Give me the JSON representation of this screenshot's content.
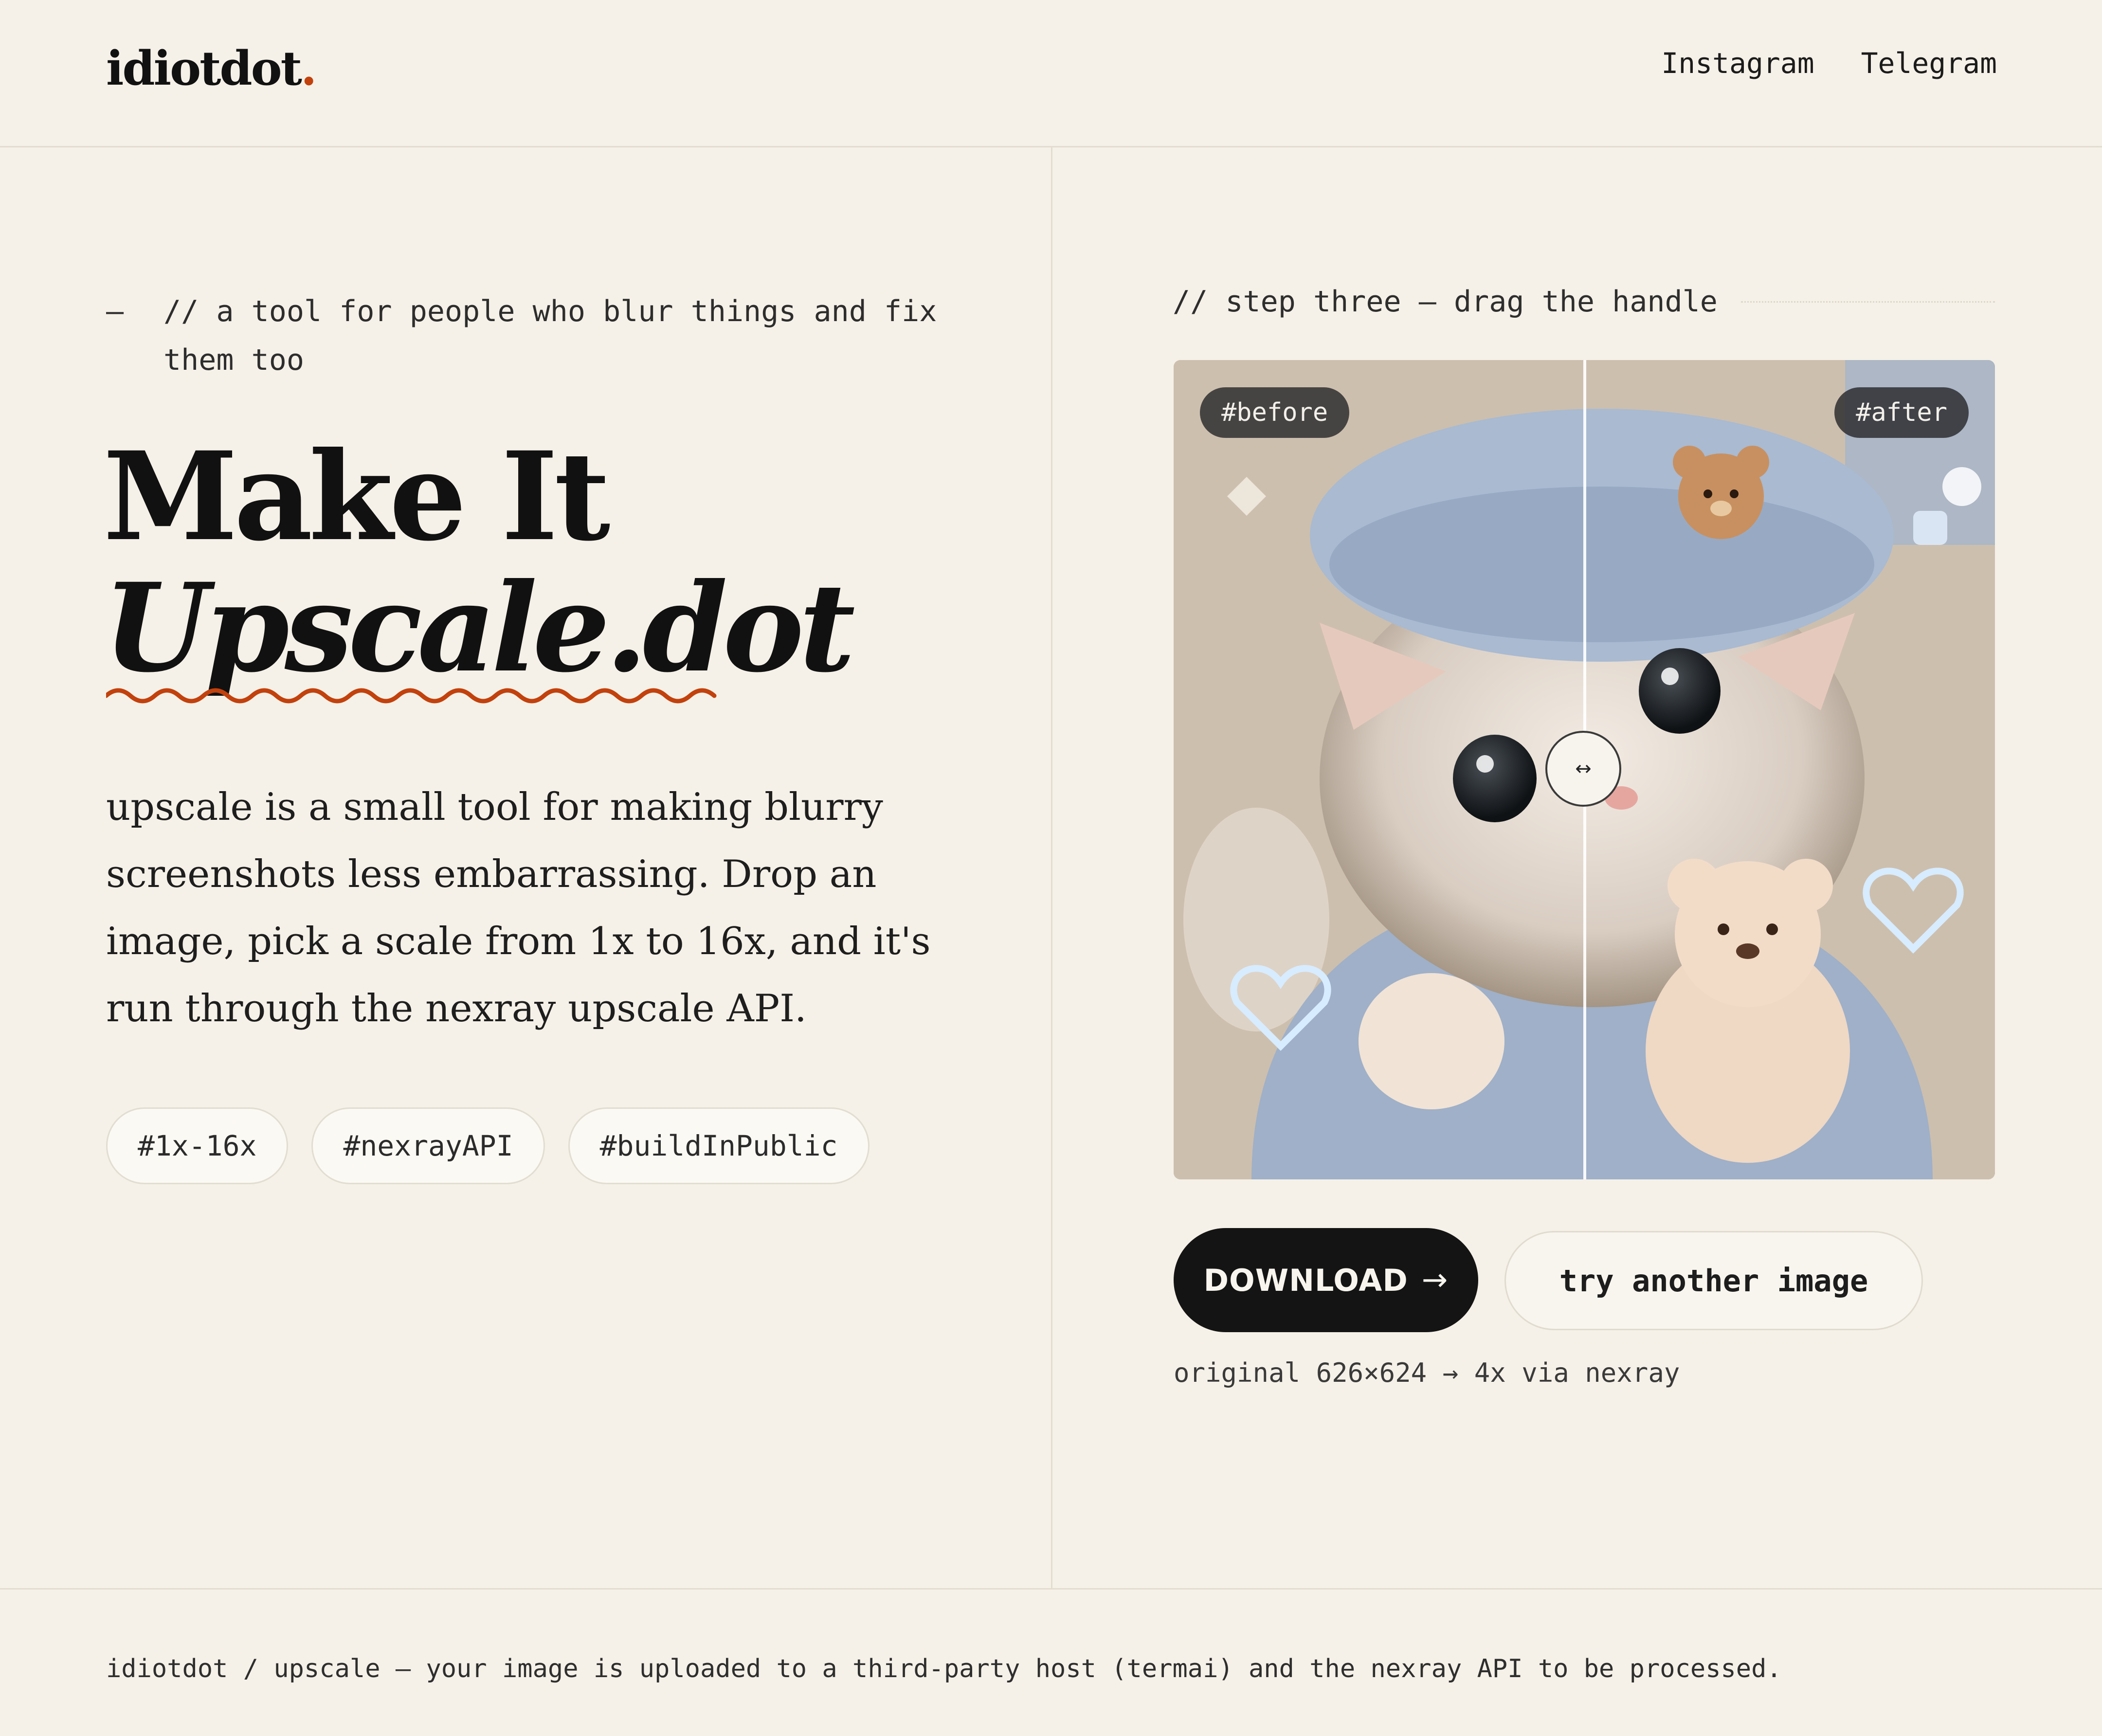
{
  "header": {
    "logo_text": "idiotdot",
    "logo_dot": ".",
    "nav": [
      "Instagram",
      "Telegram"
    ]
  },
  "hero": {
    "kicker_dash": "—",
    "kicker": "// a tool for people who blur things and fix them too",
    "title_line1": "Make It",
    "title_line2": "Upscale.dot",
    "description": "upscale is a small tool for making blurry screenshots less embarrassing. Drop an image, pick a scale from 1x to 16x, and it's run through the nexray upscale API.",
    "tags": [
      "#1x-16x",
      "#nexrayAPI",
      "#buildInPublic"
    ]
  },
  "result": {
    "step_label": "// step three — drag the handle",
    "before_badge": "#before",
    "after_badge": "#after",
    "handle_icon": "↔",
    "split_position": 0.5,
    "download_label": "DOWNLOAD",
    "download_arrow": "→",
    "try_again_label": "try another image",
    "meta": "original 626×624 → 4x via nexray"
  },
  "footer": {
    "text": "idiotdot / upscale — your image is uploaded to a third-party host (termai) and the nexray API to be processed."
  },
  "colors": {
    "background": "#f5f1e8",
    "accent": "#c2410c",
    "ink": "#141414"
  },
  "icons": {
    "handle": "resize-horizontal-icon",
    "download_arrow": "arrow-right-icon"
  }
}
